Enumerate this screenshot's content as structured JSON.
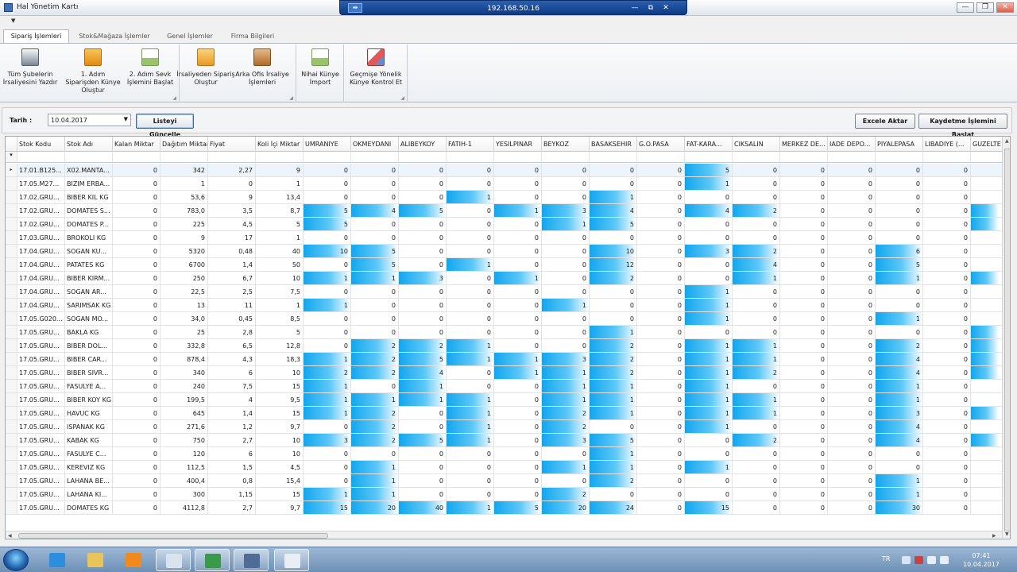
{
  "window": {
    "title": "Hal Yönetim Kartı",
    "minimize": "—",
    "restore": "❐",
    "close": "✕"
  },
  "remote": {
    "host": "192.168.50.16",
    "pin": "⇹",
    "minimize": "—",
    "restore": "⧉",
    "close": "✕"
  },
  "menu_arrow": "▼",
  "tabs": [
    {
      "label": "Sipariş İşlemleri"
    },
    {
      "label": "Stok&Mağaza İşlemler"
    },
    {
      "label": "Genel İşlemler"
    },
    {
      "label": "Firma Bilgileri"
    }
  ],
  "ribbon": {
    "groups": [
      {
        "buttons": [
          {
            "label": "Tüm Şubelerin İrsaliyesini Yazdır",
            "icon": "printer-icon",
            "color": "#7a8796"
          },
          {
            "label": "1. Adım Siparişden Künye Oluştur",
            "icon": "folder-orange-icon",
            "color": "#f2a21c"
          },
          {
            "label": "2. Adım Sevk İşlemini Başlat",
            "icon": "document-add-icon",
            "color": "#9ac46a"
          }
        ]
      },
      {
        "buttons": [
          {
            "label": "İrsaliyeden Sipariş Oluştur",
            "icon": "folder-open-icon",
            "color": "#f0b443"
          },
          {
            "label": "Arka Ofis İrsaliye İşlemleri",
            "icon": "clipboard-icon",
            "color": "#c77d3a"
          }
        ]
      },
      {
        "buttons": [
          {
            "label": "Nihai Künye İmport",
            "icon": "document-add-icon",
            "color": "#9ac46a"
          }
        ]
      },
      {
        "buttons": [
          {
            "label": "Geçmişe Yönelik Künye Kontrol Et",
            "icon": "eraser-icon",
            "color": "#e45757"
          }
        ]
      }
    ]
  },
  "filter": {
    "date_label": "Tarih  :",
    "date_value": "10.04.2017",
    "date_arrow": "▼",
    "refresh_label": "Listeyi Güncelle",
    "excel_label": "Excele Aktar",
    "save_label": "Kaydetme İşlemini Başlat"
  },
  "grid": {
    "columns": [
      "Stok Kodu",
      "Stok Adı",
      "Kalan Miktar",
      "Dağıtım Miktar",
      "Fiyat",
      "Koli İçi Miktar",
      "UMRANIYE",
      "OKMEYDANI",
      "ALIBEYKOY",
      "FATIH-1",
      "YESILPINAR",
      "BEYKOZ",
      "BASAKSEHIR",
      "G.O.PASA",
      "FAT-KARA...",
      "CIKSALIN",
      "MERKEZ DE...",
      "IADE DEPO...",
      "PIYALEPASA",
      "LIBADIYE (...",
      "GUZELTE"
    ],
    "rows": [
      {
        "code": "17.01.B125...",
        "name": "X02.MANTA...",
        "kalan": "0",
        "dagitim": "342",
        "fiyat": "2,27",
        "koli": "9",
        "stores": [
          "0",
          "0",
          "0",
          "0",
          "0",
          "0",
          "0",
          "0",
          "5",
          "0",
          "0",
          "0",
          "0",
          "0",
          ""
        ]
      },
      {
        "code": "17.05.M27...",
        "name": "BIZIM ERBA...",
        "kalan": "0",
        "dagitim": "1",
        "fiyat": "0",
        "koli": "1",
        "stores": [
          "0",
          "0",
          "0",
          "0",
          "0",
          "0",
          "0",
          "0",
          "1",
          "0",
          "0",
          "0",
          "0",
          "0",
          ""
        ]
      },
      {
        "code": "17.02.GRU...",
        "name": "BIBER KIL KG",
        "kalan": "0",
        "dagitim": "53,6",
        "fiyat": "9",
        "koli": "13,4",
        "stores": [
          "0",
          "0",
          "0",
          "1",
          "0",
          "0",
          "1",
          "0",
          "0",
          "0",
          "0",
          "0",
          "0",
          "0",
          ""
        ]
      },
      {
        "code": "17.02.GRU...",
        "name": "DOMATES S...",
        "kalan": "0",
        "dagitim": "783,0",
        "fiyat": "3,5",
        "koli": "8,7",
        "stores": [
          "5",
          "4",
          "5",
          "0",
          "1",
          "3",
          "4",
          "0",
          "4",
          "2",
          "0",
          "0",
          "0",
          "0",
          ""
        ]
      },
      {
        "code": "17.02.GRU...",
        "name": "DOMATES P...",
        "kalan": "0",
        "dagitim": "225",
        "fiyat": "4,5",
        "koli": "5",
        "stores": [
          "5",
          "0",
          "0",
          "0",
          "0",
          "1",
          "5",
          "0",
          "0",
          "0",
          "0",
          "0",
          "0",
          "0",
          ""
        ]
      },
      {
        "code": "17.03.GRU...",
        "name": "BROKOLI KG",
        "kalan": "0",
        "dagitim": "9",
        "fiyat": "17",
        "koli": "1",
        "stores": [
          "0",
          "0",
          "0",
          "0",
          "0",
          "0",
          "0",
          "0",
          "0",
          "0",
          "0",
          "0",
          "0",
          "0",
          ""
        ]
      },
      {
        "code": "17.04.GRU...",
        "name": "SOGAN KU...",
        "kalan": "0",
        "dagitim": "5320",
        "fiyat": "0,48",
        "koli": "40",
        "stores": [
          "10",
          "5",
          "0",
          "0",
          "0",
          "0",
          "10",
          "0",
          "3",
          "2",
          "0",
          "0",
          "6",
          "0",
          ""
        ]
      },
      {
        "code": "17.04.GRU...",
        "name": "PATATES KG",
        "kalan": "0",
        "dagitim": "6700",
        "fiyat": "1,4",
        "koli": "50",
        "stores": [
          "0",
          "5",
          "0",
          "1",
          "0",
          "0",
          "12",
          "0",
          "0",
          "4",
          "0",
          "0",
          "5",
          "0",
          ""
        ]
      },
      {
        "code": "17.04.GRU...",
        "name": "BIBER KIRM...",
        "kalan": "0",
        "dagitim": "250",
        "fiyat": "6,7",
        "koli": "10",
        "stores": [
          "1",
          "1",
          "3",
          "0",
          "1",
          "0",
          "2",
          "0",
          "0",
          "1",
          "0",
          "0",
          "1",
          "0",
          ""
        ]
      },
      {
        "code": "17.04.GRU...",
        "name": "SOGAN AR...",
        "kalan": "0",
        "dagitim": "22,5",
        "fiyat": "2,5",
        "koli": "7,5",
        "stores": [
          "0",
          "0",
          "0",
          "0",
          "0",
          "0",
          "0",
          "0",
          "1",
          "0",
          "0",
          "0",
          "0",
          "0",
          ""
        ]
      },
      {
        "code": "17.04.GRU...",
        "name": "SARIMSAK KG",
        "kalan": "0",
        "dagitim": "13",
        "fiyat": "11",
        "koli": "1",
        "stores": [
          "1",
          "0",
          "0",
          "0",
          "0",
          "1",
          "0",
          "0",
          "1",
          "0",
          "0",
          "0",
          "0",
          "0",
          ""
        ]
      },
      {
        "code": "17.05.G020...",
        "name": "SOGAN MO...",
        "kalan": "0",
        "dagitim": "34,0",
        "fiyat": "0,45",
        "koli": "8,5",
        "stores": [
          "0",
          "0",
          "0",
          "0",
          "0",
          "0",
          "0",
          "0",
          "1",
          "0",
          "0",
          "0",
          "1",
          "0",
          ""
        ]
      },
      {
        "code": "17.05.GRU...",
        "name": "BAKLA KG",
        "kalan": "0",
        "dagitim": "25",
        "fiyat": "2,8",
        "koli": "5",
        "stores": [
          "0",
          "0",
          "0",
          "0",
          "0",
          "0",
          "1",
          "0",
          "0",
          "0",
          "0",
          "0",
          "0",
          "0",
          ""
        ]
      },
      {
        "code": "17.05.GRU...",
        "name": "BIBER DOL...",
        "kalan": "0",
        "dagitim": "332,8",
        "fiyat": "6,5",
        "koli": "12,8",
        "stores": [
          "0",
          "2",
          "2",
          "1",
          "0",
          "0",
          "2",
          "0",
          "1",
          "1",
          "0",
          "0",
          "2",
          "0",
          ""
        ]
      },
      {
        "code": "17.05.GRU...",
        "name": "BIBER CAR...",
        "kalan": "0",
        "dagitim": "878,4",
        "fiyat": "4,3",
        "koli": "18,3",
        "stores": [
          "1",
          "2",
          "5",
          "1",
          "1",
          "3",
          "2",
          "0",
          "1",
          "1",
          "0",
          "0",
          "4",
          "0",
          ""
        ]
      },
      {
        "code": "17.05.GRU...",
        "name": "BIBER SIVR...",
        "kalan": "0",
        "dagitim": "340",
        "fiyat": "6",
        "koli": "10",
        "stores": [
          "2",
          "2",
          "4",
          "0",
          "1",
          "1",
          "2",
          "0",
          "1",
          "2",
          "0",
          "0",
          "4",
          "0",
          ""
        ]
      },
      {
        "code": "17.05.GRU...",
        "name": "FASULYE A...",
        "kalan": "0",
        "dagitim": "240",
        "fiyat": "7,5",
        "koli": "15",
        "stores": [
          "1",
          "0",
          "1",
          "0",
          "0",
          "1",
          "1",
          "0",
          "1",
          "0",
          "0",
          "0",
          "1",
          "0",
          ""
        ]
      },
      {
        "code": "17.05.GRU...",
        "name": "BIBER KOY KG",
        "kalan": "0",
        "dagitim": "199,5",
        "fiyat": "4",
        "koli": "9,5",
        "stores": [
          "1",
          "1",
          "1",
          "1",
          "0",
          "1",
          "1",
          "0",
          "1",
          "1",
          "0",
          "0",
          "1",
          "0",
          ""
        ]
      },
      {
        "code": "17.05.GRU...",
        "name": "HAVUC KG",
        "kalan": "0",
        "dagitim": "645",
        "fiyat": "1,4",
        "koli": "15",
        "stores": [
          "1",
          "2",
          "0",
          "1",
          "0",
          "2",
          "1",
          "0",
          "1",
          "1",
          "0",
          "0",
          "3",
          "0",
          ""
        ]
      },
      {
        "code": "17.05.GRU...",
        "name": "ISPANAK KG",
        "kalan": "0",
        "dagitim": "271,6",
        "fiyat": "1,2",
        "koli": "9,7",
        "stores": [
          "0",
          "2",
          "0",
          "1",
          "0",
          "2",
          "0",
          "0",
          "1",
          "0",
          "0",
          "0",
          "4",
          "0",
          ""
        ]
      },
      {
        "code": "17.05.GRU...",
        "name": "KABAK KG",
        "kalan": "0",
        "dagitim": "750",
        "fiyat": "2,7",
        "koli": "10",
        "stores": [
          "3",
          "2",
          "5",
          "1",
          "0",
          "3",
          "5",
          "0",
          "0",
          "2",
          "0",
          "0",
          "4",
          "0",
          ""
        ]
      },
      {
        "code": "17.05.GRU...",
        "name": "FASULYE C...",
        "kalan": "0",
        "dagitim": "120",
        "fiyat": "6",
        "koli": "10",
        "stores": [
          "0",
          "0",
          "0",
          "0",
          "0",
          "0",
          "1",
          "0",
          "0",
          "0",
          "0",
          "0",
          "0",
          "0",
          ""
        ]
      },
      {
        "code": "17.05.GRU...",
        "name": "KEREVIZ KG",
        "kalan": "0",
        "dagitim": "112,5",
        "fiyat": "1,5",
        "koli": "4,5",
        "stores": [
          "0",
          "1",
          "0",
          "0",
          "0",
          "1",
          "1",
          "0",
          "1",
          "0",
          "0",
          "0",
          "0",
          "0",
          ""
        ]
      },
      {
        "code": "17.05.GRU...",
        "name": "LAHANA BE...",
        "kalan": "0",
        "dagitim": "400,4",
        "fiyat": "0,8",
        "koli": "15,4",
        "stores": [
          "0",
          "1",
          "0",
          "0",
          "0",
          "0",
          "2",
          "0",
          "0",
          "0",
          "0",
          "0",
          "1",
          "0",
          ""
        ]
      },
      {
        "code": "17.05.GRU...",
        "name": "LAHANA KI...",
        "kalan": "0",
        "dagitim": "300",
        "fiyat": "1,15",
        "koli": "15",
        "stores": [
          "1",
          "1",
          "0",
          "0",
          "0",
          "2",
          "0",
          "0",
          "0",
          "0",
          "0",
          "0",
          "1",
          "0",
          ""
        ]
      },
      {
        "code": "17.05.GRU...",
        "name": "DOMATES KG",
        "kalan": "0",
        "dagitim": "4112,8",
        "fiyat": "2,7",
        "koli": "9,7",
        "stores": [
          "15",
          "20",
          "40",
          "1",
          "5",
          "20",
          "24",
          "0",
          "15",
          "0",
          "0",
          "0",
          "30",
          "0",
          ""
        ]
      }
    ],
    "guzeltepe_fill": [
      0,
      0,
      0,
      0.9,
      0.9,
      0,
      0,
      0,
      0.9,
      0,
      0,
      0,
      0.9,
      0.9,
      0.9,
      0.9,
      0,
      0,
      0.9,
      0,
      0.9,
      0,
      0,
      0,
      0,
      0
    ],
    "selected_row_marker": "▸",
    "filter_marker": "▾",
    "bar_color": "#12a6ee"
  },
  "taskbar": {
    "items": [
      {
        "icon": "ie-icon",
        "color": "#2d8ee0"
      },
      {
        "icon": "explorer-icon",
        "color": "#e9c45a"
      },
      {
        "icon": "media-player-icon",
        "color": "#f08a1e"
      },
      {
        "icon": "chart-app-icon",
        "color": "#d9e3ef",
        "active": true
      },
      {
        "icon": "globe-icon",
        "color": "#3a9a4a",
        "active": true
      },
      {
        "icon": "remote-desktop-icon",
        "color": "#4f6b96",
        "active": true
      },
      {
        "icon": "app-window-icon",
        "color": "#e9eef4",
        "active": true
      }
    ],
    "lang": "TR",
    "time": "07:41",
    "date": "10.04.2017"
  }
}
